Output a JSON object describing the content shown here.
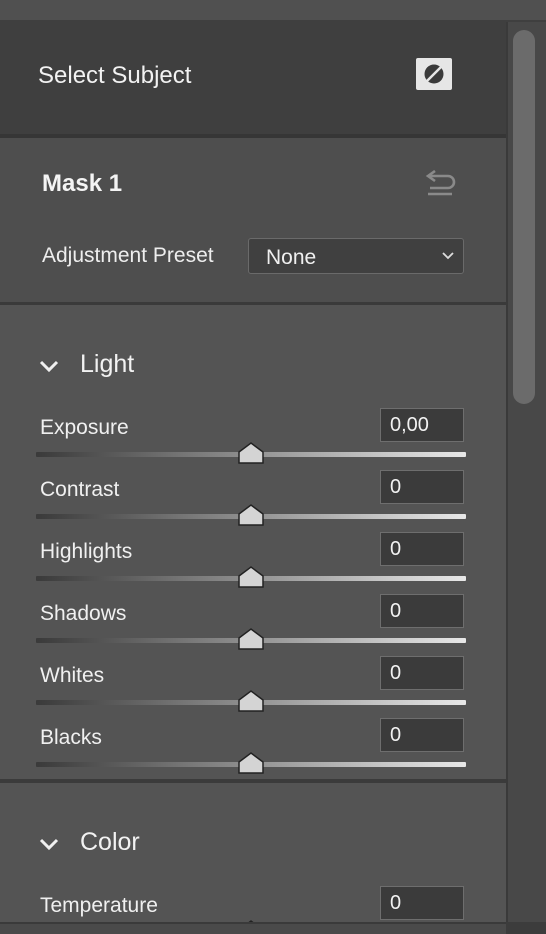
{
  "select_subject": {
    "label": "Select Subject",
    "overlay_icon": "mask-overlay-icon"
  },
  "mask": {
    "title": "Mask 1",
    "reset_icon": "undo-icon",
    "preset_label": "Adjustment Preset",
    "preset_value": "None"
  },
  "light": {
    "title": "Light",
    "sliders": [
      {
        "label": "Exposure",
        "value": "0,00",
        "position": 0.5
      },
      {
        "label": "Contrast",
        "value": "0",
        "position": 0.5
      },
      {
        "label": "Highlights",
        "value": "0",
        "position": 0.5
      },
      {
        "label": "Shadows",
        "value": "0",
        "position": 0.5
      },
      {
        "label": "Whites",
        "value": "0",
        "position": 0.5
      },
      {
        "label": "Blacks",
        "value": "0",
        "position": 0.5
      }
    ]
  },
  "color": {
    "title": "Color",
    "sliders": [
      {
        "label": "Temperature",
        "value": "0",
        "position": 0.5
      }
    ]
  },
  "colors": {
    "panel_bg": "#545454",
    "header_bg": "#3f3f3f",
    "temp_cold": "#2a2dbb",
    "temp_warm": "#ece840"
  }
}
